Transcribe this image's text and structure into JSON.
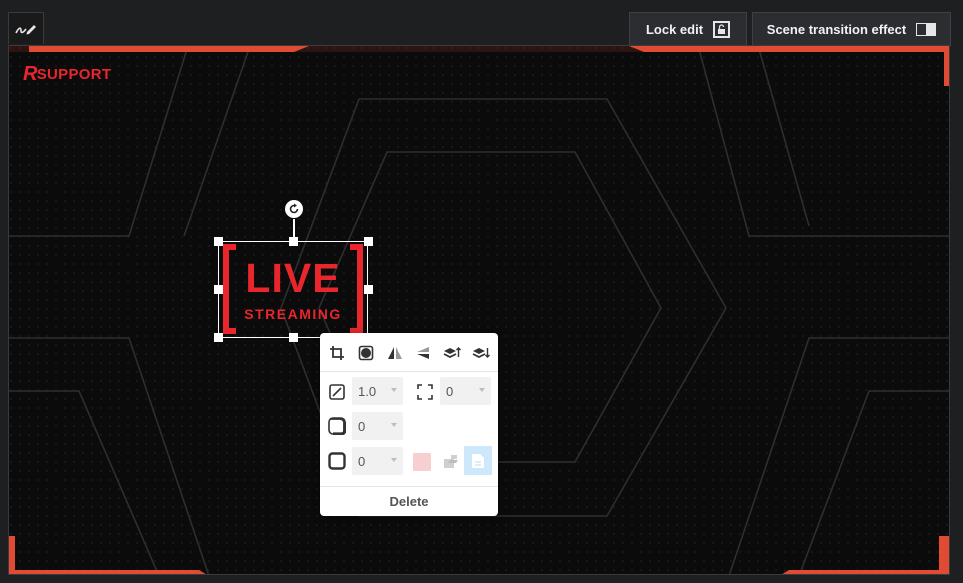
{
  "toolbar": {
    "pen_icon": "pen-draw-icon",
    "lock_label": "Lock edit",
    "lock_icon": "lock-open-icon",
    "scene_label": "Scene transition effect",
    "scene_icon": "half-square-icon"
  },
  "stage": {
    "brand": "SUPPORT",
    "brand_mark": "R",
    "accent_color": "#f04a3a",
    "brand_color": "#e8262c"
  },
  "layer": {
    "title": "LIVE",
    "subtitle": "STREAMING",
    "rotate_icon": "rotate-icon"
  },
  "context_menu": {
    "tools": [
      "crop-icon",
      "mask-icon",
      "flip-horizontal-icon",
      "flip-vertical-icon",
      "bring-forward-icon",
      "send-backward-icon"
    ],
    "opacity_value": "1.0",
    "padding_value": "0",
    "radius_value": "0",
    "border_value": "0",
    "delete_label": "Delete",
    "border_color": "#f8cfd1",
    "paste_color": "#cde8fb"
  }
}
